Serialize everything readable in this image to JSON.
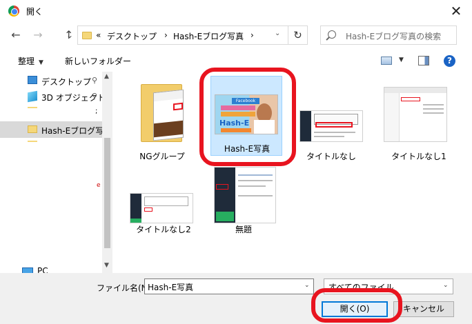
{
  "window": {
    "title": "開く"
  },
  "nav": {
    "back_icon": "arrow-left-icon",
    "forward_icon": "arrow-right-icon",
    "up_icon": "arrow-up-icon",
    "up_glyph": "↑",
    "back_glyph": "←",
    "forward_glyph": "→"
  },
  "address": {
    "overflow": "«",
    "segments": [
      "デスクトップ",
      "Hash-Eブログ写真"
    ],
    "separator": "›",
    "dropdown_glyph": "⌄",
    "refresh_glyph": "↻"
  },
  "search": {
    "placeholder": "Hash-Eブログ写真の検索"
  },
  "toolbar": {
    "organize_label": "整理",
    "caret": "▼",
    "new_folder_label": "新しいフォルダー",
    "help_label": "?"
  },
  "sidebar": {
    "items": [
      {
        "label": "デスクトップ",
        "pin": "📌"
      },
      {
        "label": "3D オブジェクト",
        "pin": "📌"
      },
      {
        "label": "Hash-Eブログ写真"
      },
      {
        "label": "PC"
      }
    ],
    "scroll_up": "▲",
    "scroll_down": "▼"
  },
  "files": [
    {
      "name": "NGグループ",
      "type": "folder"
    },
    {
      "name": "Hash-E写真",
      "type": "image",
      "selected": true
    },
    {
      "name": "タイトルなし",
      "type": "image"
    },
    {
      "name": "タイトルなし1",
      "type": "image"
    },
    {
      "name": "タイトルなし2",
      "type": "image"
    },
    {
      "name": "無題",
      "type": "image"
    }
  ],
  "thumb_text": {
    "facebook": "Facebook",
    "hash": "Hash-E"
  },
  "bottom": {
    "filename_label": "ファイル名(N):",
    "filename_value": "Hash-E写真",
    "filetype_value": "すべてのファイル",
    "dd_glyph": "⌄",
    "open_label": "開く(O)",
    "cancel_label": "キャンセル"
  },
  "colors": {
    "annotation_red": "#e8141f",
    "selection": "#cce8ff",
    "accent": "#0078d7"
  }
}
